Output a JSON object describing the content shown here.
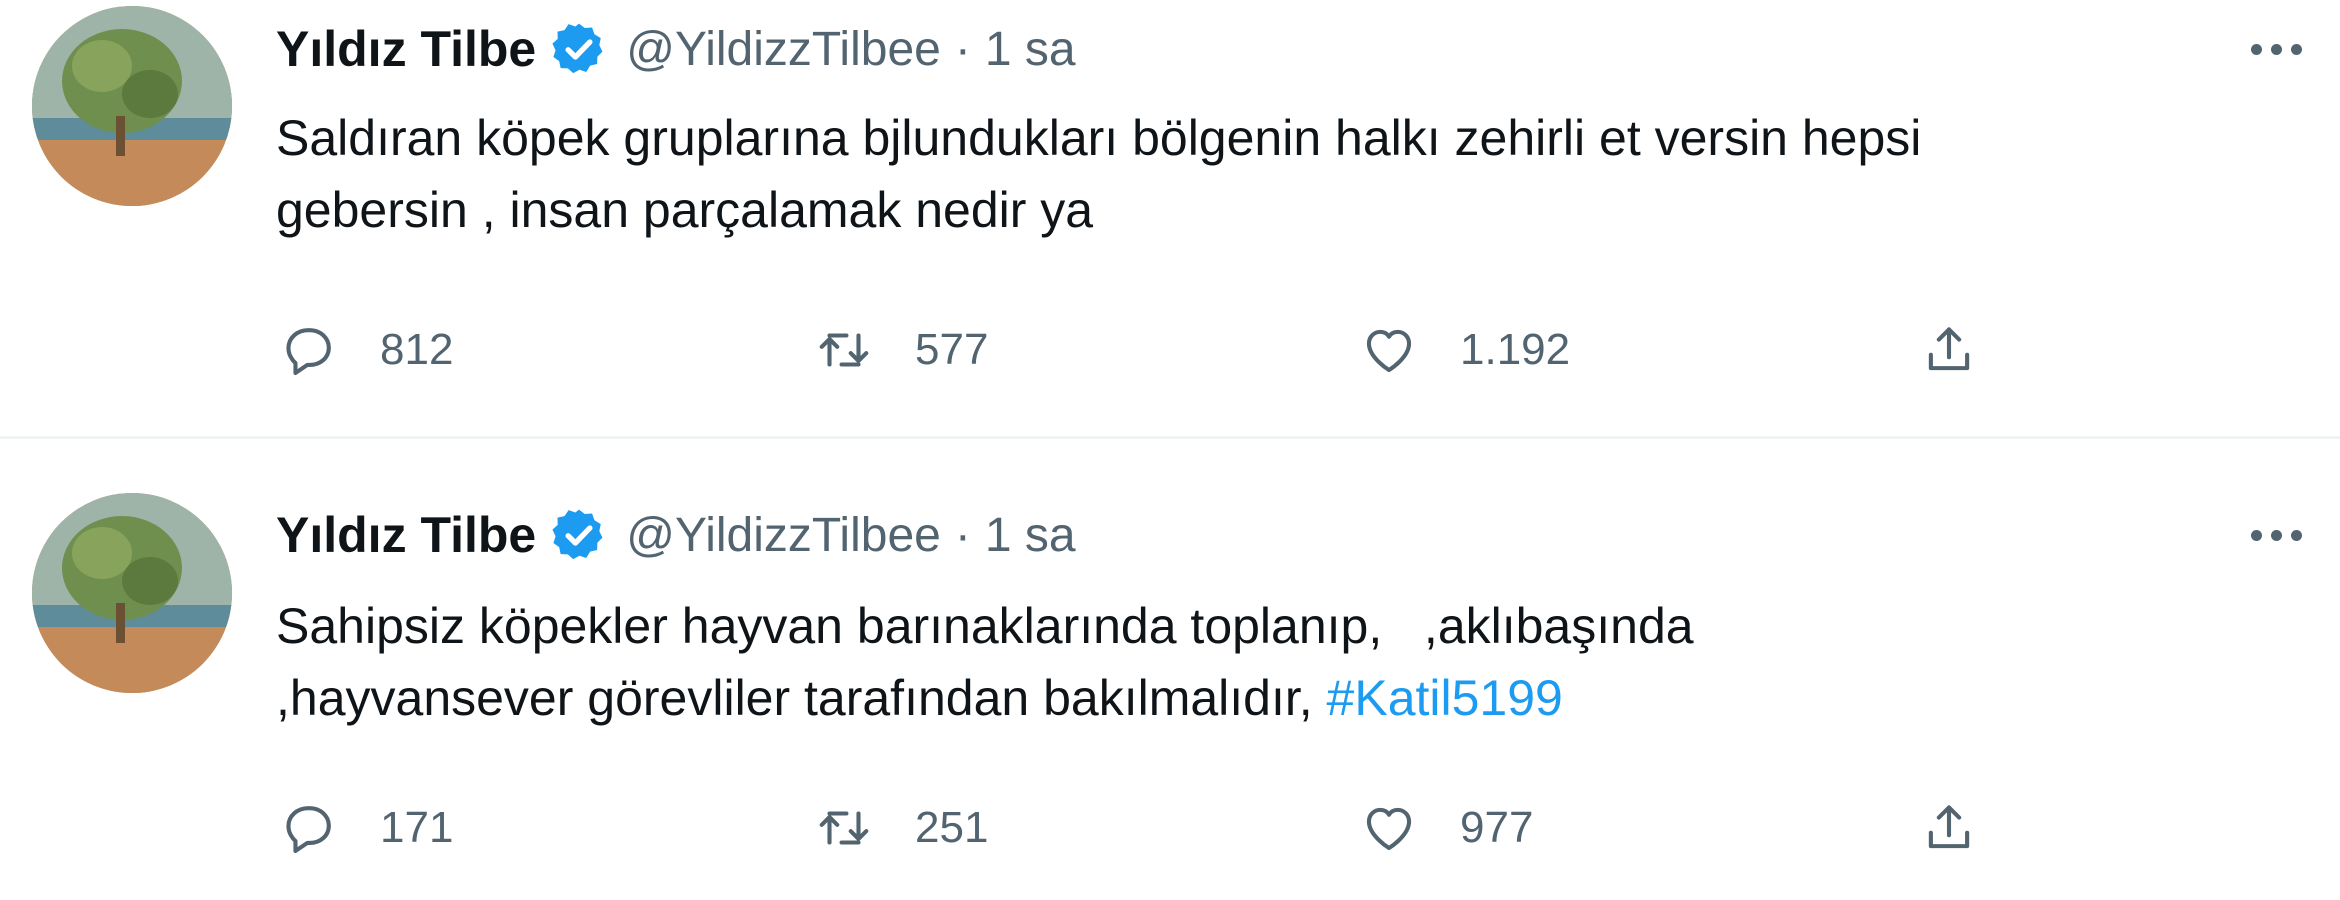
{
  "tweets": [
    {
      "author_name": "Yıldız Tilbe",
      "handle": "@YildizzTilbee",
      "separator": "·",
      "time": "1 sa",
      "text_line1": "Saldıran köpek gruplarına bjlundukları bölgenin halkı zehirli et versin hepsi",
      "text_line2": "gebersin , insan parçalamak nedir ya",
      "hashtag": "",
      "replies": "812",
      "retweets": "577",
      "likes": "1.192"
    },
    {
      "author_name": "Yıldız Tilbe",
      "handle": "@YildizzTilbee",
      "separator": "·",
      "time": "1 sa",
      "text_line1": "Sahipsiz köpekler hayvan barınaklarında toplanıp,   ,aklıbaşında",
      "text_line2": ",hayvansever görevliler tarafından bakılmalıdır, ",
      "hashtag": "#Katil5199",
      "replies": "171",
      "retweets": "251",
      "likes": "977"
    }
  ],
  "icons": {
    "verified": "verified-badge-icon",
    "more": "more-options-icon",
    "reply": "reply-icon",
    "retweet": "retweet-icon",
    "like": "like-icon",
    "share": "share-icon"
  },
  "colors": {
    "text": "#0f1419",
    "secondary": "#536471",
    "accent": "#1d9bf0",
    "divider": "#eff3f4"
  }
}
